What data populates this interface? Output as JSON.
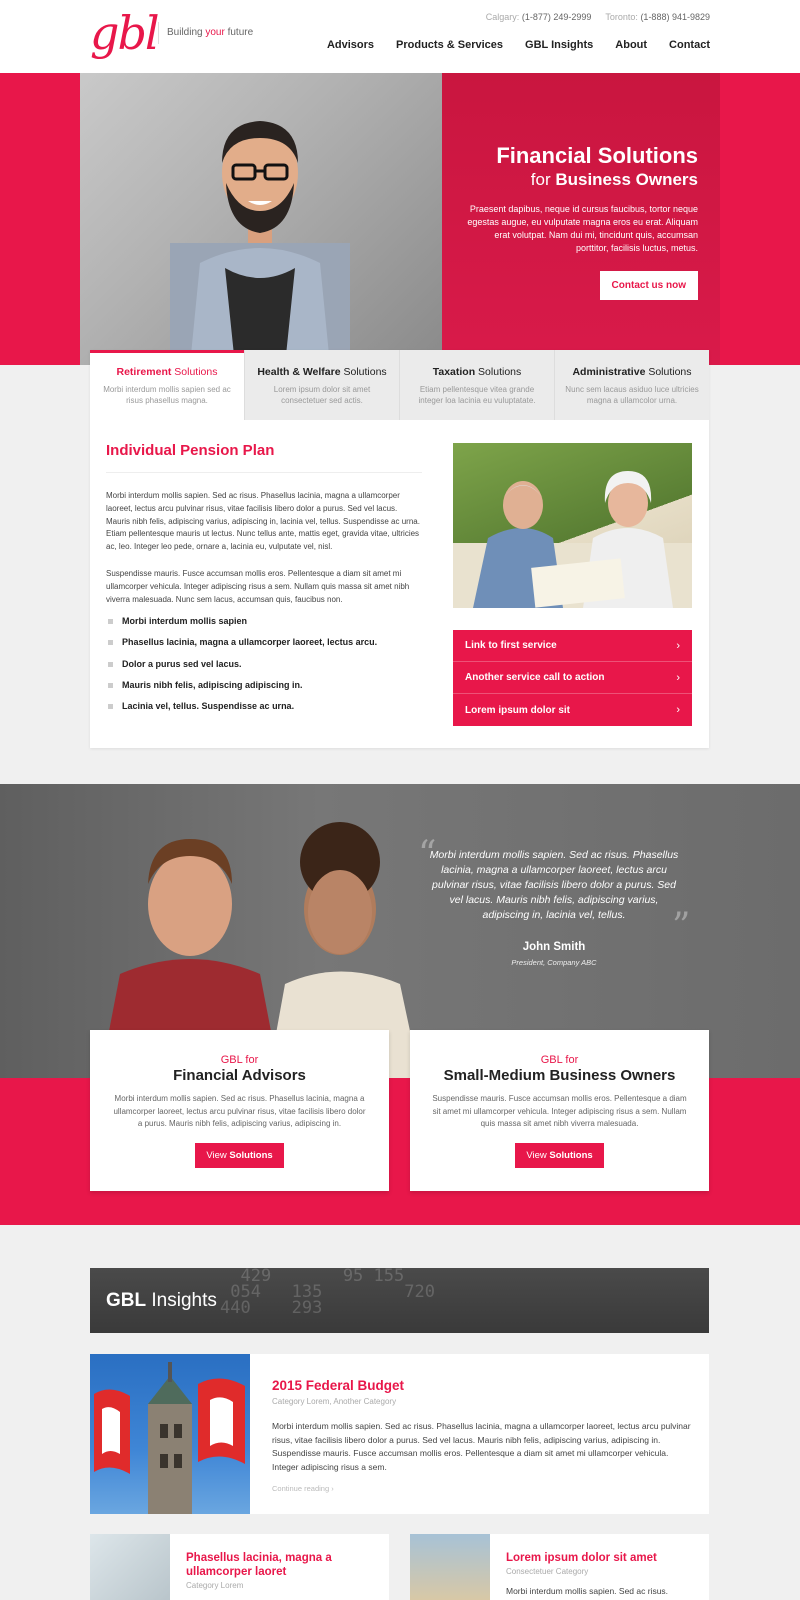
{
  "header": {
    "logo": "gbl",
    "tagline_pre": "Building ",
    "tagline_accent": "your",
    "tagline_post": " future",
    "phone_calgary_label": "Calgary:",
    "phone_calgary": "(1-877) 249-2999",
    "phone_toronto_label": "Toronto:",
    "phone_toronto": "(1-888) 941-9829",
    "nav": [
      "Advisors",
      "Products & Services",
      "GBL Insights",
      "About",
      "Contact"
    ]
  },
  "hero": {
    "title": "Financial Solutions",
    "sub_pre": "for ",
    "sub_bold": "Business Owners",
    "text": "Praesent dapibus, neque id cursus faucibus, tortor neque egestas augue, eu vulputate magna eros eu erat. Aliquam erat volutpat. Nam dui mi, tincidunt quis, accumsan porttitor, facilisis luctus, metus.",
    "button": "Contact us now"
  },
  "solutions": {
    "tabs": [
      {
        "bold": "Retirement",
        "rest": " Solutions",
        "desc": "Morbi interdum mollis sapien sed ac risus phasellus magna."
      },
      {
        "bold": "Health & Welfare",
        "rest": " Solutions",
        "desc": "Lorem ipsum dolor sit amet consectetuer sed actis."
      },
      {
        "bold": "Taxation",
        "rest": " Solutions",
        "desc": "Etiam pellentesque vitea grande integer loa lacinia eu vuluptatate."
      },
      {
        "bold": "Administrative",
        "rest": " Solutions",
        "desc": "Nunc sem lacaus asiduo luce ultricies magna a ullamcolor urna."
      }
    ],
    "title": "Individual Pension Plan",
    "p1": "Morbi interdum mollis sapien. Sed ac risus. Phasellus lacinia, magna a ullamcorper laoreet, lectus arcu pulvinar risus, vitae facilisis libero dolor a purus. Sed vel lacus. Mauris nibh felis, adipiscing varius, adipiscing in, lacinia vel, tellus. Suspendisse ac urna. Etiam pellentesque mauris ut lectus. Nunc tellus ante, mattis eget, gravida vitae, ultricies ac, leo. Integer leo pede, ornare a, lacinia eu, vulputate vel, nisl.",
    "p2": "Suspendisse mauris. Fusce accumsan mollis eros. Pellentesque a diam sit amet mi ullamcorper vehicula. Integer adipiscing risus a sem. Nullam quis massa sit amet nibh viverra malesuada. Nunc sem lacus, accumsan quis, faucibus non.",
    "bullets": [
      "Morbi interdum mollis sapien",
      "Phasellus lacinia, magna a ullamcorper laoreet, lectus arcu.",
      "Dolor a purus sed vel lacus.",
      "Mauris nibh felis, adipiscing adipiscing in.",
      "Lacinia vel, tellus. Suspendisse ac urna."
    ],
    "ctas": [
      "Link to first service",
      "Another service call to action",
      "Lorem ipsum dolor sit"
    ]
  },
  "testimonial": {
    "quote": "Morbi interdum mollis sapien. Sed ac risus. Phasellus lacinia, magna a ullamcorper laoreet, lectus arcu pulvinar risus, vitae facilisis libero dolor a purus. Sed vel lacus. Mauris nibh felis, adipiscing varius, adipiscing in, lacinia vel, tellus.",
    "name": "John Smith",
    "role": "President, Company ABC"
  },
  "audiences": [
    {
      "for": "GBL for",
      "title": "Financial Advisors",
      "text": "Morbi interdum mollis sapien. Sed ac risus. Phasellus lacinia, magna a ullamcorper laoreet, lectus arcu pulvinar risus, vitae facilisis libero dolor a purus. Mauris nibh felis, adipiscing varius, adipiscing in.",
      "btn_pre": "View ",
      "btn_bold": "Solutions"
    },
    {
      "for": "GBL for",
      "title": "Small-Medium Business Owners",
      "text": "Suspendisse mauris. Fusce accumsan mollis eros. Pellentesque a diam sit amet mi ullamcorper vehicula. Integer adipiscing risus a sem. Nullam quis massa sit amet nibh viverra malesuada.",
      "btn_pre": "View ",
      "btn_bold": "Solutions"
    }
  ],
  "insights": {
    "title_bold": "GBL",
    "title_rest": " Insights",
    "main": {
      "title": "2015 Federal Budget",
      "category": "Category Lorem, Another Category",
      "text": "Morbi interdum mollis sapien. Sed ac risus. Phasellus lacinia, magna a ullamcorper laoreet, lectus arcu pulvinar risus, vitae facilisis libero dolor a purus. Sed vel lacus. Mauris nibh felis, adipiscing varius, adipiscing in. Suspendisse mauris. Fusce accumsan mollis eros. Pellentesque a diam sit amet mi ullamcorper vehicula. Integer adipiscing risus a sem.",
      "more": "Continue reading ›"
    },
    "small": [
      {
        "title": "Phasellus lacinia, magna a ullamcorper laoret",
        "category": "Category Lorem",
        "text": ""
      },
      {
        "title": "Lorem ipsum dolor sit amet",
        "category": "Consectetuer Category",
        "text": "Morbi interdum mollis sapien. Sed ac risus."
      }
    ]
  },
  "colors": {
    "accent": "#e8174a",
    "dark": "#3a3a3a",
    "light_bg": "#f0f0f0"
  }
}
